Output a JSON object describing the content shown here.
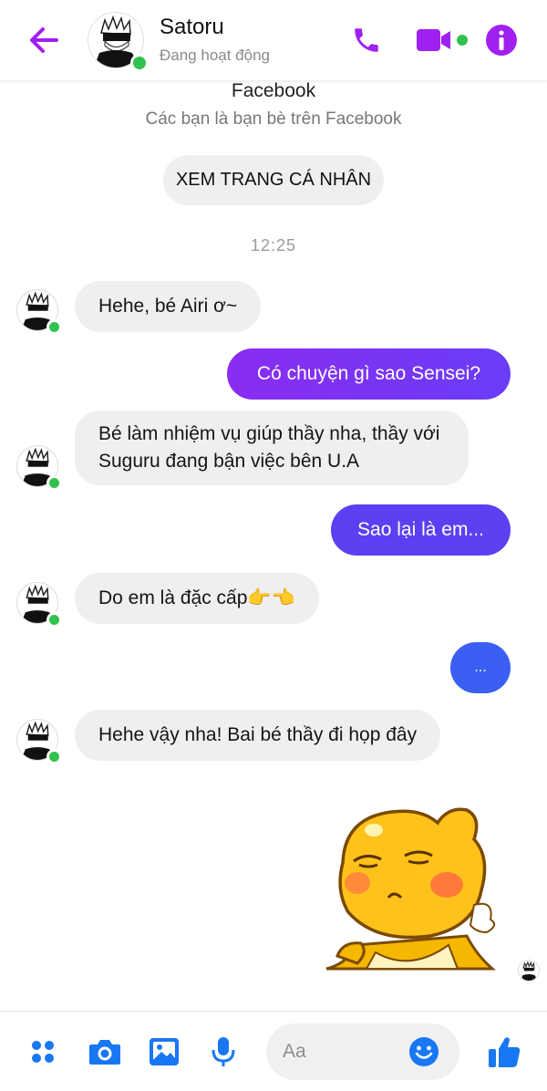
{
  "header": {
    "contact_name": "Satoru",
    "status": "Đang hoạt động",
    "icons": [
      "back-arrow-icon",
      "phone-icon",
      "video-camera-icon",
      "info-icon"
    ],
    "accent": "#a020f0",
    "online_color": "#31c24d"
  },
  "intro": {
    "title": "Facebook",
    "subtitle": "Các bạn là bạn bè trên Facebook",
    "profile_button": "XEM TRANG CÁ NHÂN"
  },
  "timestamp": "12:25",
  "messages": [
    {
      "from": "them",
      "text": "Hehe, bé Airi ơ~"
    },
    {
      "from": "me",
      "text": "Có chuyện gì sao Sensei?"
    },
    {
      "from": "them",
      "text": "Bé làm nhiệm vụ giúp thầy nha, thầy với Suguru đang bận việc bên U.A"
    },
    {
      "from": "me",
      "text": "Sao lại là em..."
    },
    {
      "from": "them",
      "text": "Do em là đặc cấp👉👈"
    },
    {
      "from": "me",
      "text": "..."
    },
    {
      "from": "them",
      "text": "Hehe vậy nha! Bai bé thầy đi họp đây"
    }
  ],
  "sticker": {
    "name": "yellow-blob-sticker"
  },
  "composer": {
    "placeholder": "Aa",
    "icons": [
      "menu-dots-icon",
      "camera-icon",
      "image-icon",
      "microphone-icon",
      "emoji-icon",
      "thumbs-up-icon"
    ],
    "icon_color": "#1877f2"
  }
}
